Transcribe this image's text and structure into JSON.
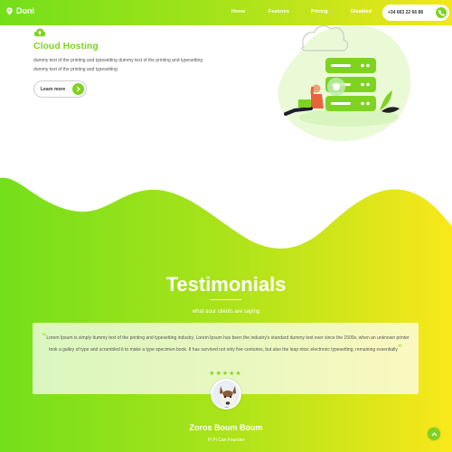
{
  "brand": {
    "name": "Doni"
  },
  "nav": {
    "items": [
      {
        "label": "Home"
      },
      {
        "label": "Features"
      },
      {
        "label": "Pricing"
      },
      {
        "label": "Disabled"
      }
    ],
    "phone": "+34 663 22 66 88"
  },
  "hero": {
    "title": "Cloud Hosting",
    "text": "dummy text of the printing and typesetting dummy text of the printing and typesetting dummy text of the printing and typesetting",
    "button_label": "Learn more"
  },
  "testimonials": {
    "title": "Testimonials",
    "subtitle": "what aour clients are saying",
    "quote": "Lorem Ipsum is simply dummy text of the printing and typesetting industry. Lorem Ipsum has been the industry's standard dummy text ever since the 1500s, when an unknown printer took a galley of type and scrambled it to make a type specimen book. It has survived not only five centuries, but also the leap intoc electronic typesetting, remaining essentially",
    "stars": "★★★★★",
    "name": "Zoros Boum Boum",
    "role": "Pi Pi Can Founder"
  },
  "colors": {
    "green": "#7ed321",
    "lime": "#a6e22e",
    "yellow": "#f5e71a"
  },
  "icons": [
    "location-pin-icon",
    "phone-icon",
    "cloud-upload-icon",
    "arrow-right-icon",
    "chevron-up-icon"
  ]
}
